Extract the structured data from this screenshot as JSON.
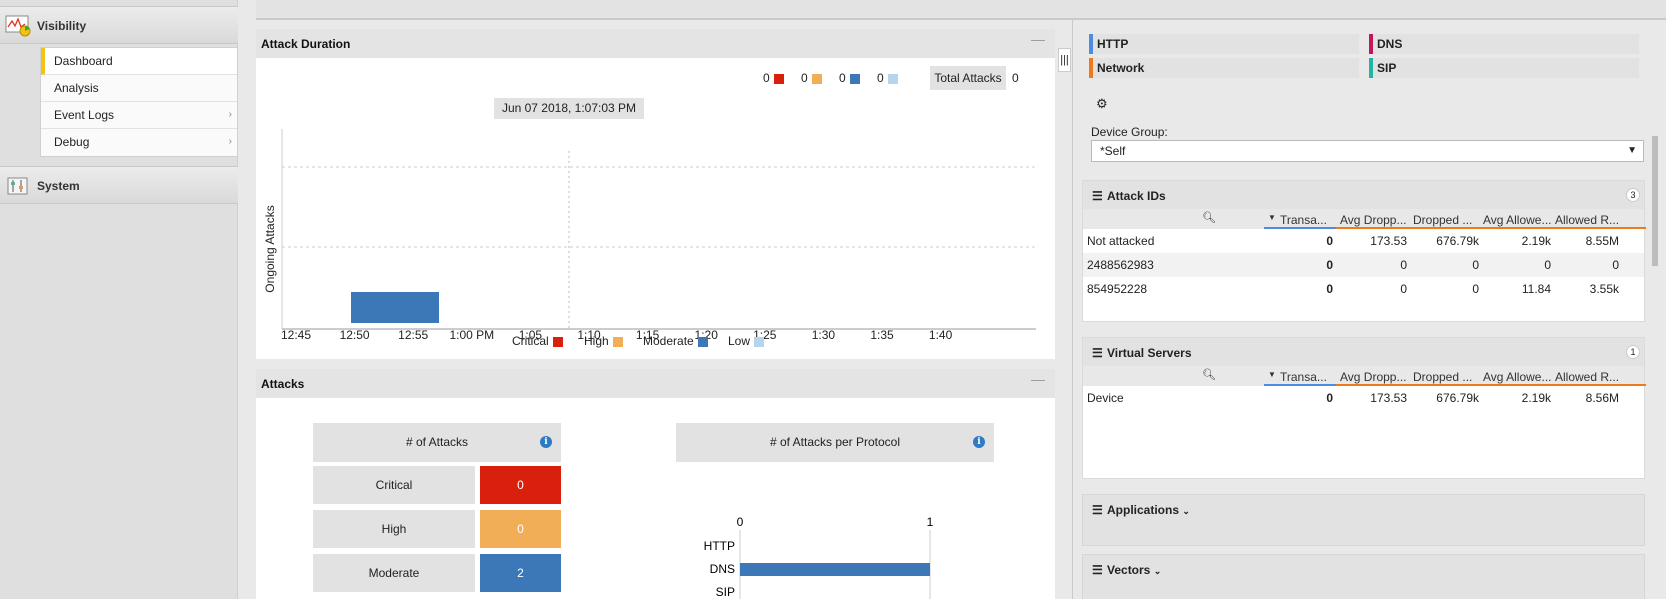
{
  "nav": {
    "visibility_label": "Visibility",
    "system_label": "System",
    "items": [
      {
        "label": "Dashboard"
      },
      {
        "label": "Analysis"
      },
      {
        "label": "Event Logs"
      },
      {
        "label": "Debug"
      }
    ]
  },
  "attack_duration": {
    "title": "Attack Duration",
    "counts": [
      "0",
      "0",
      "0",
      "0"
    ],
    "total_label": "Total Attacks",
    "total_value": "0",
    "tooltip": "Jun 07 2018, 1:07:03 PM",
    "ylabel": "Ongoing Attacks",
    "legend": [
      {
        "label": "Critical",
        "color": "#d9200c"
      },
      {
        "label": "High",
        "color": "#f2ae57"
      },
      {
        "label": "Moderate",
        "color": "#3c78b8"
      },
      {
        "label": "Low",
        "color": "#b6d5ec"
      }
    ]
  },
  "attacks": {
    "title": "Attacks",
    "num_attacks_label": "# of Attacks",
    "per_protocol_label": "# of Attacks per Protocol",
    "severity": [
      {
        "label": "Critical",
        "value": "0",
        "color": "#d9200c"
      },
      {
        "label": "High",
        "value": "0",
        "color": "#f2ae57"
      },
      {
        "label": "Moderate",
        "value": "2",
        "color": "#3c78b8"
      }
    ]
  },
  "chart_data": [
    {
      "type": "bar",
      "title": "Attack Duration",
      "ylabel": "Ongoing Attacks",
      "x_ticks": [
        "12:45",
        "12:50",
        "12:55",
        "1:00 PM",
        "1:05",
        "1:10",
        "1:15",
        "1:20",
        "1:25",
        "1:30",
        "1:35",
        "1:40"
      ],
      "bars": [
        {
          "start": "12:50",
          "end": "12:57",
          "series": "Moderate",
          "value": 1
        }
      ],
      "grid": true
    },
    {
      "type": "bar",
      "title": "# of Attacks per Protocol",
      "categories": [
        "HTTP",
        "DNS",
        "SIP"
      ],
      "values": [
        0,
        1,
        0
      ],
      "x_ticks": [
        "0",
        "1"
      ],
      "xlim": [
        0,
        1
      ]
    }
  ],
  "right": {
    "protocols": [
      {
        "label": "HTTP",
        "color": "#4c8de0"
      },
      {
        "label": "DNS",
        "color": "#c2185b"
      },
      {
        "label": "Network",
        "color": "#ef7a1a"
      },
      {
        "label": "SIP",
        "color": "#1fb5a0"
      }
    ],
    "device_group_label": "Device Group:",
    "device_group_value": "*Self",
    "columns": [
      "Transa...",
      "Avg Dropp...",
      "Dropped ...",
      "Avg Allowe...",
      "Allowed R..."
    ],
    "attack_ids": {
      "title": "Attack IDs",
      "count": "3",
      "rows": [
        {
          "name": "Not attacked",
          "vals": [
            "0",
            "173.53",
            "676.79k",
            "2.19k",
            "8.55M"
          ]
        },
        {
          "name": "2488562983",
          "vals": [
            "0",
            "0",
            "0",
            "0",
            "0"
          ]
        },
        {
          "name": "854952228",
          "vals": [
            "0",
            "0",
            "0",
            "11.84",
            "3.55k"
          ]
        }
      ]
    },
    "virtual_servers": {
      "title": "Virtual Servers",
      "count": "1",
      "rows": [
        {
          "name": "Device",
          "vals": [
            "0",
            "173.53",
            "676.79k",
            "2.19k",
            "8.56M"
          ]
        }
      ]
    },
    "applications_label": "Applications",
    "vectors_label": "Vectors"
  }
}
